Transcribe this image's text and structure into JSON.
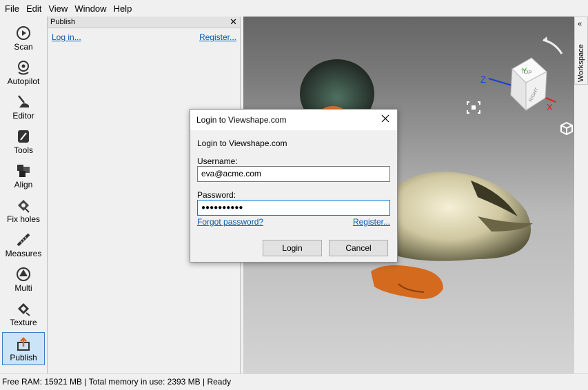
{
  "menu": {
    "file": "File",
    "edit": "Edit",
    "view": "View",
    "window": "Window",
    "help": "Help"
  },
  "tools": [
    {
      "label": "Scan",
      "icon": "scan-icon"
    },
    {
      "label": "Autopilot",
      "icon": "autopilot-icon"
    },
    {
      "label": "Editor",
      "icon": "editor-icon"
    },
    {
      "label": "Tools",
      "icon": "tools-icon"
    },
    {
      "label": "Align",
      "icon": "align-icon"
    },
    {
      "label": "Fix holes",
      "icon": "fix-holes-icon"
    },
    {
      "label": "Measures",
      "icon": "measures-icon"
    },
    {
      "label": "Multi",
      "icon": "multi-icon"
    },
    {
      "label": "Texture",
      "icon": "texture-icon"
    },
    {
      "label": "Publish",
      "icon": "publish-icon",
      "active": true
    }
  ],
  "panel": {
    "title": "Publish",
    "close": "✕",
    "login_link": "Log in...",
    "register_link": "Register..."
  },
  "workspace": {
    "label": "Workspace",
    "chevron": "«"
  },
  "viewcube": {
    "top": "TOP",
    "right": "RIGHT",
    "axis_x": "X",
    "axis_y": "Y",
    "axis_z": "Z"
  },
  "dialog": {
    "title": "Login to Viewshape.com",
    "heading": "Login to Viewshape.com",
    "username_label": "Username:",
    "username_value": "eva@acme.com",
    "password_label": "Password:",
    "password_value": "●●●●●●●●●●",
    "forgot_link": "Forgot password?",
    "register_link": "Register...",
    "login_button": "Login",
    "cancel_button": "Cancel"
  },
  "status": {
    "text": "Free RAM: 15921 MB  |  Total memory in use: 2393 MB  |    Ready"
  },
  "colors": {
    "accent": "#0078d7",
    "link": "#0b5cad",
    "active_tool_bg": "#cce4f7",
    "axis_x": "#e01a1a",
    "axis_y": "#22aa22",
    "axis_z": "#1a3cdc"
  }
}
